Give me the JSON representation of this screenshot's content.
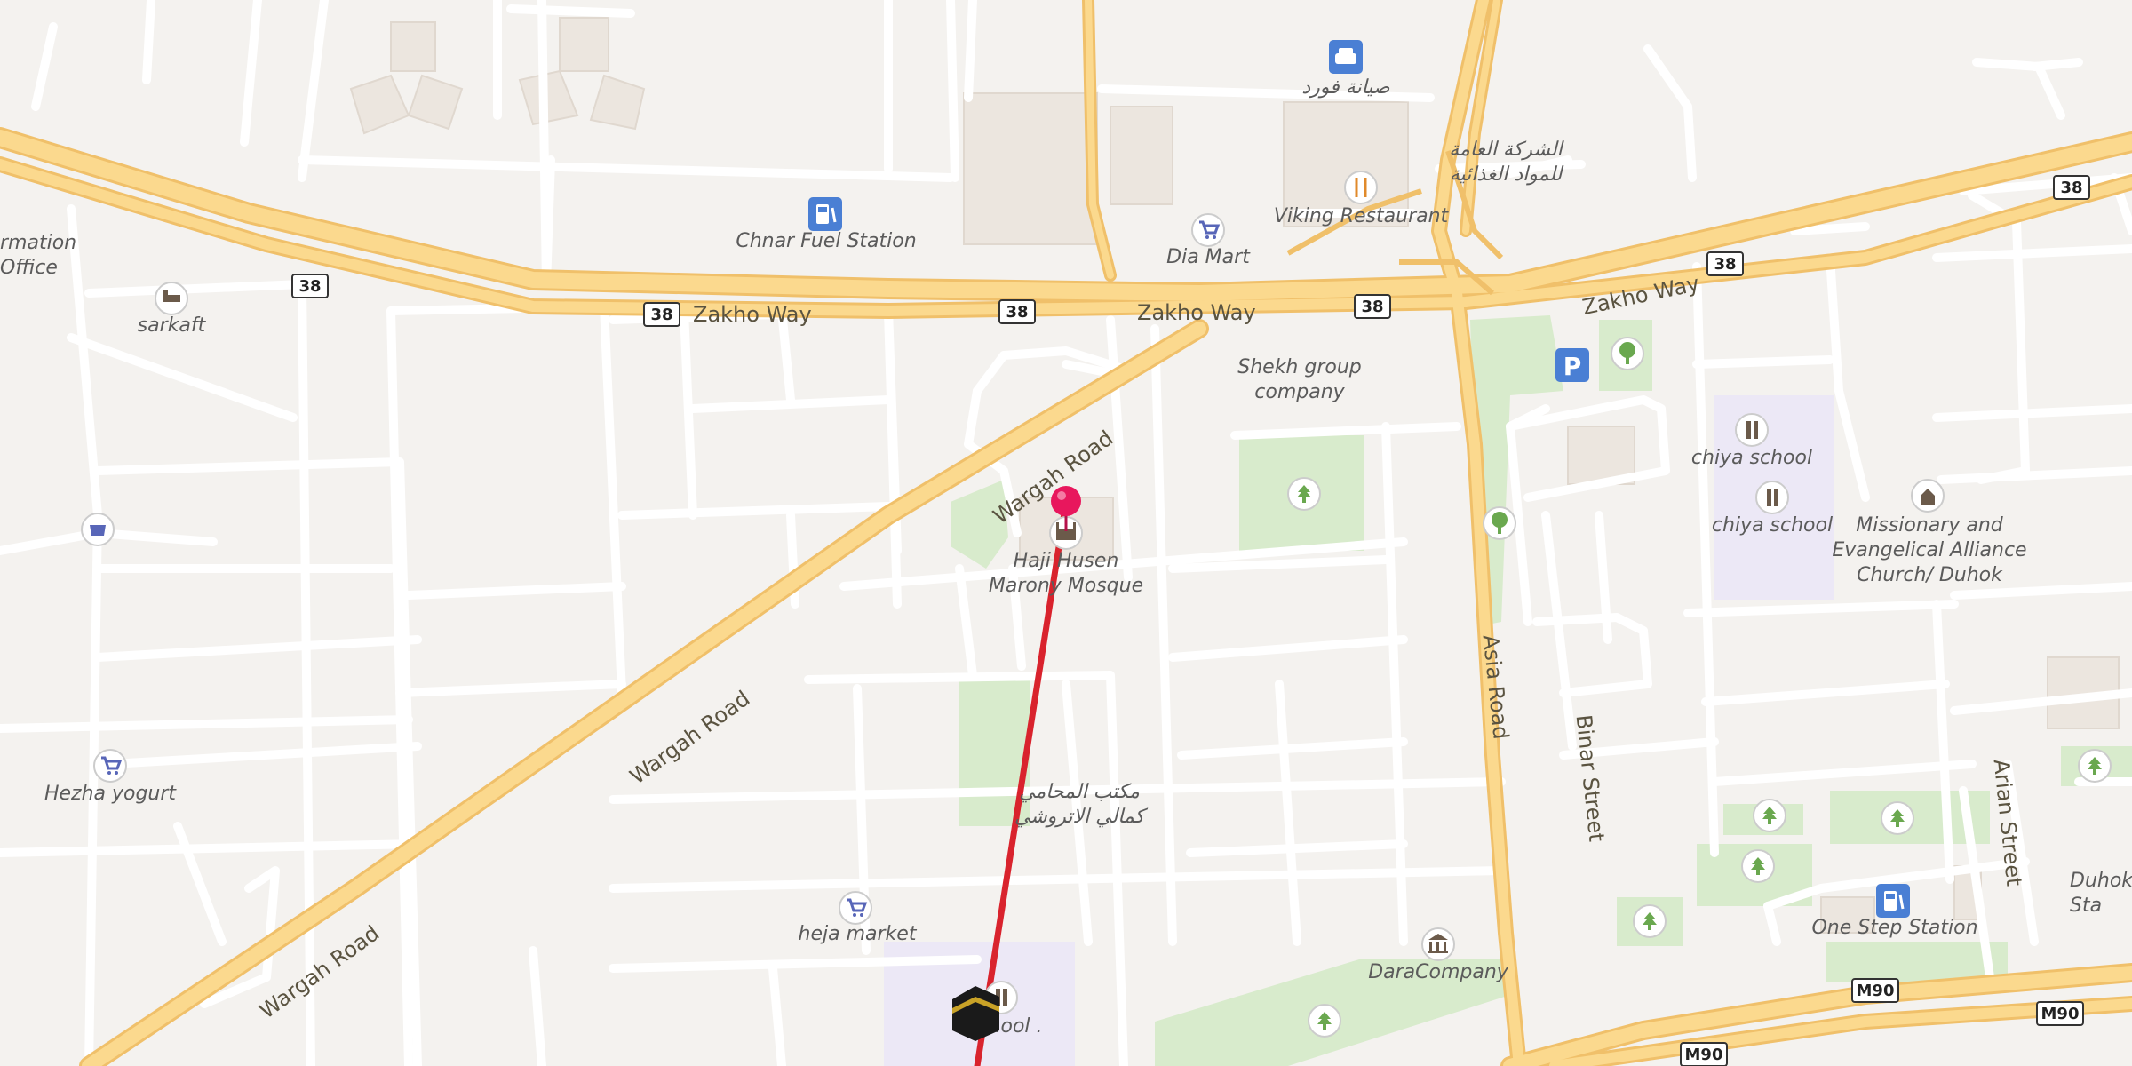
{
  "roads": {
    "zakho_way": "Zakho Way",
    "wargah_road": "Wargah Road",
    "asia_road": "Asia Road",
    "binar_street": "Binar Street",
    "arian_street": "Arian Street"
  },
  "shields": {
    "r38": "38",
    "m90": "M90"
  },
  "places": {
    "information_office": "rmation Office",
    "chnar_fuel": "Chnar Fuel Station",
    "dia_mart": "Dia Mart",
    "viking_restaurant": "Viking Restaurant",
    "foreign_car": "صيانة فورد",
    "foreign_company": "الشركة العامة للمواد الغذائية",
    "sarkaft": "sarkaft",
    "shekh_group": "Shekh group company",
    "chiya_school_1": "chiya school",
    "chiya_school_2": "chiya school",
    "missionary": "Missionary and Evangelical Alliance Church/ Duhok",
    "mosque": "Haji Husen Marony Mosque",
    "foreign_office": "مكتب المحامي كمالي الاتروشي",
    "hezha_yogurt": "Hezha yogurt",
    "heja_market": "heja market",
    "dara_company": "DaraCompany",
    "one_step_station": "One Step Station",
    "duhok": "Duhok Sta",
    "school": "School ."
  },
  "colors": {
    "background": "#f4f2ef",
    "major_road": "#fbd98e",
    "major_road_casing": "#f0c06a",
    "minor_road": "#ffffff",
    "park": "#d8ebcc",
    "school_area": "#ece8f6",
    "route_line": "#d9232d",
    "pin": "#e8175d",
    "poi_blue": "#4a7fd4"
  }
}
